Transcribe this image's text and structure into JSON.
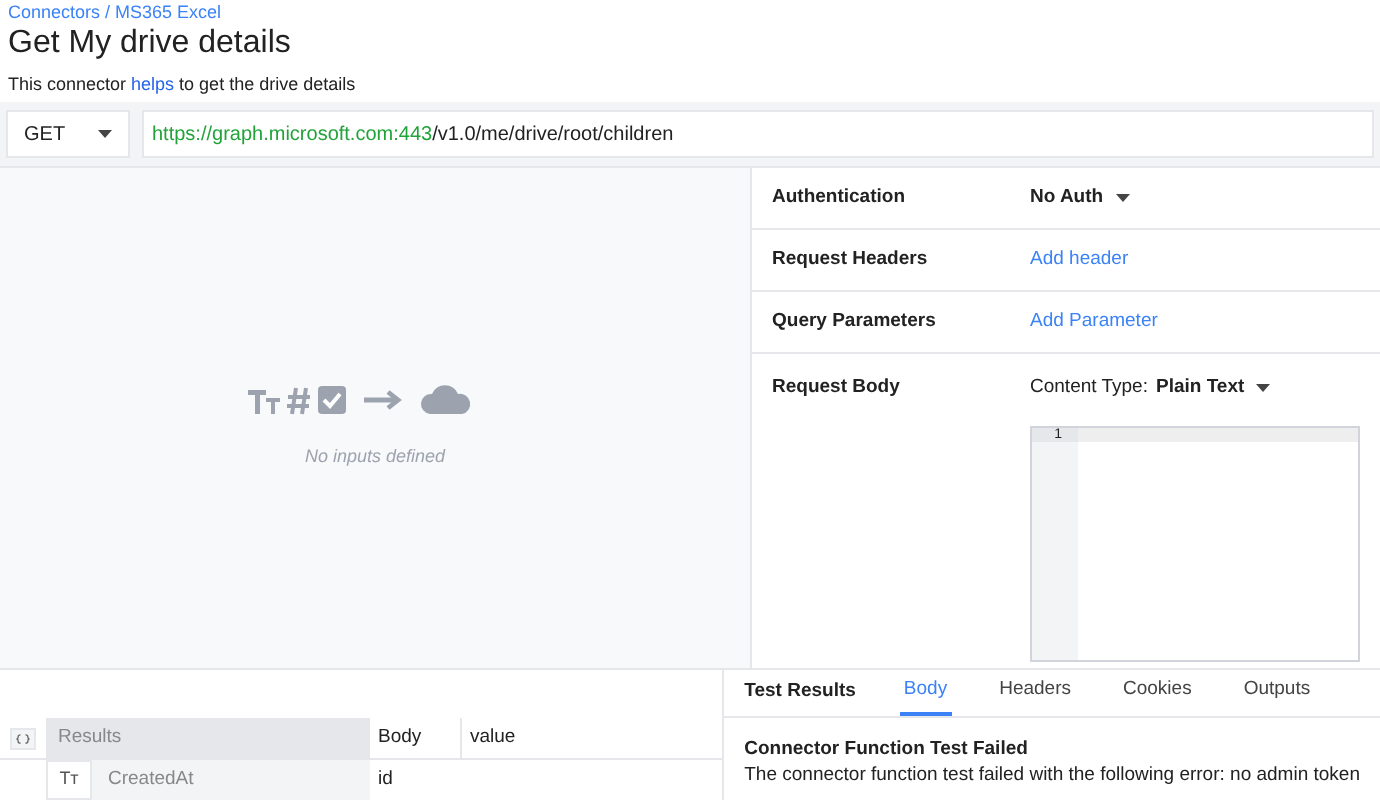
{
  "breadcrumb": "Connectors / MS365 Excel",
  "title": "Get My drive details",
  "description": {
    "before": "This connector ",
    "link": "helps",
    "after": " to get the drive details"
  },
  "request": {
    "method": "GET",
    "url_host": "https://graph.microsoft.com:443",
    "url_path": "/v1.0/me/drive/root/children"
  },
  "inputs_panel": {
    "empty_text": "No inputs defined"
  },
  "settings": [
    {
      "label": "Authentication",
      "kind": "dropdown",
      "value": "No Auth"
    },
    {
      "label": "Request Headers",
      "kind": "link",
      "value": "Add header"
    },
    {
      "label": "Query Parameters",
      "kind": "link",
      "value": "Add Parameter"
    },
    {
      "label": "Request Body",
      "kind": "body",
      "prefix": "Content Type:",
      "value": "Plain Text",
      "line_number": "1"
    }
  ],
  "results_table": {
    "header": [
      "Results",
      "Body",
      "value"
    ],
    "row": {
      "type_icon": "Tт",
      "name": "CreatedAt",
      "value": "id"
    }
  },
  "test_results": {
    "title": "Test Results",
    "tabs": [
      {
        "label": "Body",
        "selected": true
      },
      {
        "label": "Headers",
        "selected": false
      },
      {
        "label": "Cookies",
        "selected": false
      },
      {
        "label": "Outputs",
        "selected": false
      }
    ],
    "message_title": "Connector Function Test Failed",
    "message": "The connector function test failed with the following error: no admin token"
  }
}
